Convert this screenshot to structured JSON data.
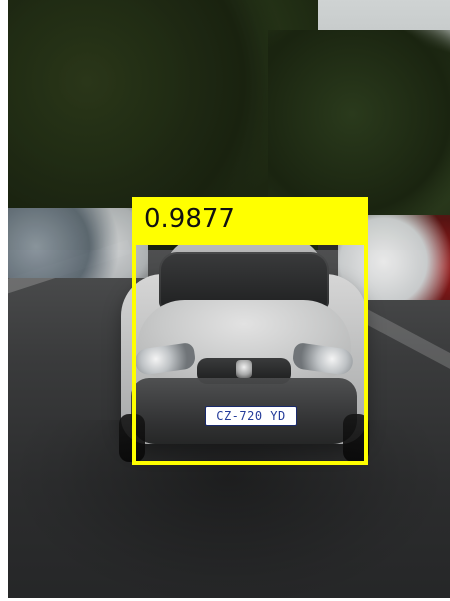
{
  "detection": {
    "confidence_label": "0.9877",
    "confidence": 0.9877,
    "color": "#ffff00"
  },
  "vehicle": {
    "license_plate": "CZ-720 YD"
  }
}
